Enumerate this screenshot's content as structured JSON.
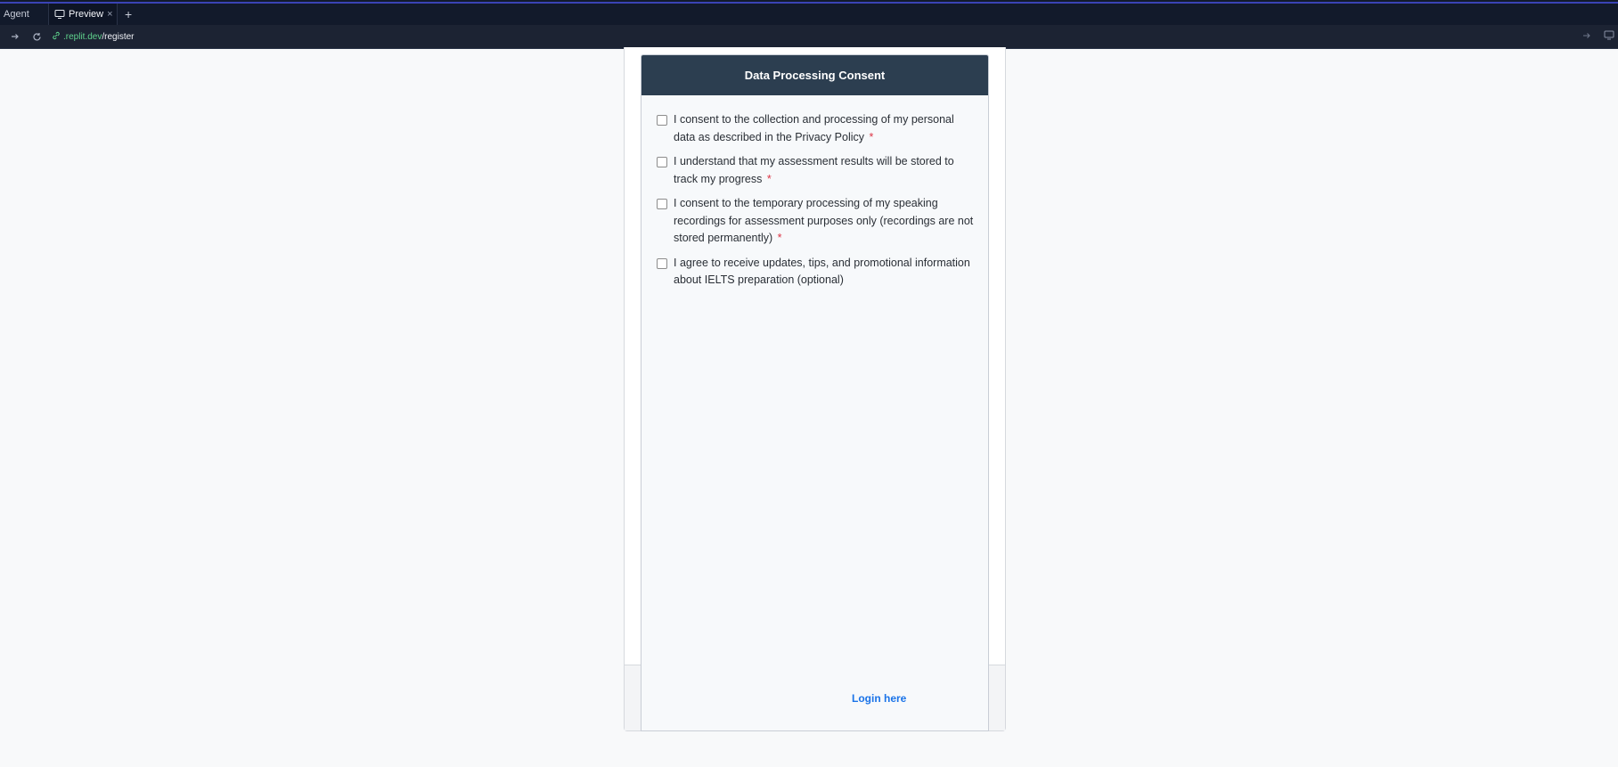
{
  "tabs": {
    "agent_label": "Agent",
    "preview_label": "Preview",
    "close_glyph": "×",
    "add_glyph": "+"
  },
  "address": {
    "domain": ".replit.dev",
    "path": "/register"
  },
  "modal": {
    "title": "Data Processing Consent",
    "items": [
      {
        "text": "I consent to the collection and processing of my personal data as described in the Privacy Policy",
        "required": "*"
      },
      {
        "text": "I understand that my assessment results will be stored to track my progress",
        "required": "*"
      },
      {
        "text": "I consent to the temporary processing of my speaking recordings for assessment purposes only (recordings are not stored permanently)",
        "required": "*"
      },
      {
        "text": "I agree to receive updates, tips, and promotional information about IELTS preparation (optional)",
        "required": ""
      }
    ]
  },
  "footer": {
    "login_link": "Login here"
  }
}
